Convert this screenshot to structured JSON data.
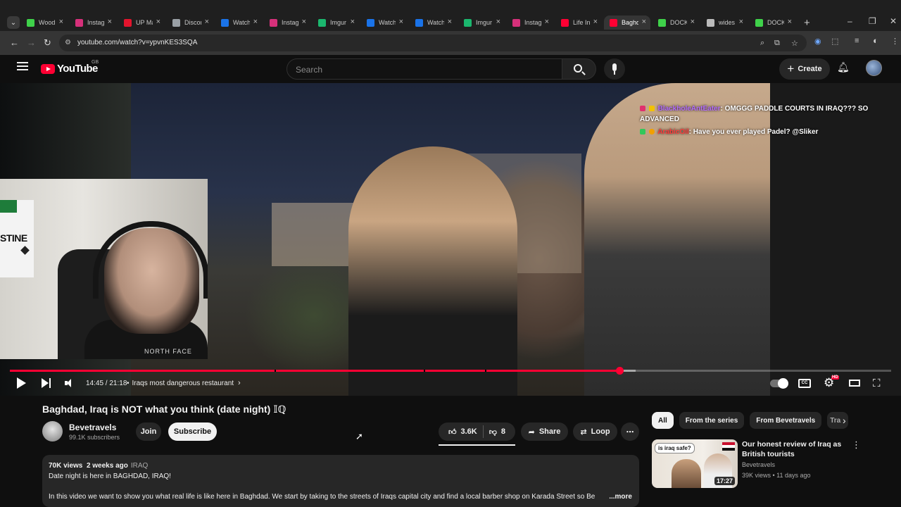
{
  "browser": {
    "tabs": [
      {
        "label": "Wood",
        "color": "#3fd14a"
      },
      {
        "label": "Instag",
        "color": "#d6307a"
      },
      {
        "label": "UP Ma",
        "color": "#e3142d"
      },
      {
        "label": "Discor",
        "color": "#9aa0a6"
      },
      {
        "label": "Watch",
        "color": "#1a73e8"
      },
      {
        "label": "Instag",
        "color": "#d6307a"
      },
      {
        "label": "Imgur",
        "color": "#1bb76e"
      },
      {
        "label": "Watch",
        "color": "#1a73e8"
      },
      {
        "label": "Watch",
        "color": "#1a73e8"
      },
      {
        "label": "Imgur",
        "color": "#1bb76e"
      },
      {
        "label": "Instag",
        "color": "#d6307a"
      },
      {
        "label": "Life In",
        "color": "#ff0033"
      },
      {
        "label": "Baghd",
        "color": "#ff0033",
        "active": true
      },
      {
        "label": "DOCK",
        "color": "#3fd14a"
      },
      {
        "label": "wides",
        "color": "#bbbbbb"
      },
      {
        "label": "DOCK",
        "color": "#3fd14a"
      }
    ],
    "url": "youtube.com/watch?v=ypvnKES3SQA"
  },
  "youtube": {
    "logo": "YouTube",
    "region": "GB",
    "search_placeholder": "Search",
    "create_label": "Create"
  },
  "player": {
    "chat": [
      {
        "user": "BlackholeAntEater",
        "message": ": OMGGG PADDLE COURTS IN IRAQ??? SO ADVANCED",
        "user_color": "#b36bff"
      },
      {
        "user": "ArabicOil",
        "message": ": Have you ever played Padel? @Sliker",
        "user_color": "#ff3b3b"
      }
    ],
    "webcam_poster_text": "STINE",
    "webcam_shirt_text": "NORTH FACE",
    "time": "14:45 / 21:18",
    "chapter": "Iraqs most dangerous restaurant",
    "progress_fraction": 0.692,
    "buffer_fraction": 0.71,
    "settings_badge": "HD",
    "cc_label": "CC"
  },
  "video": {
    "title": "Baghdad, Iraq is NOT what you think (date night) 𝕀ℚ",
    "channel": "Bevetravels",
    "subscribers": "99.1K subscribers",
    "join_label": "Join",
    "subscribe_label": "Subscribe",
    "likes": "3.6K",
    "dislikes": "8",
    "share_label": "Share",
    "loop_label": "Loop",
    "views": "70K views",
    "age": "2 weeks ago",
    "tag": "IRAQ",
    "desc_line1": "Date night is here in BAGHDAD, IRAQ!",
    "desc_line2": "In this video we want to show you what real life is like here in Baghdad. We start by taking to the streets of Iraqs capital city and find a local barber shop on Karada Street so Be",
    "desc_more": "...more"
  },
  "sidebar": {
    "chips": [
      "All",
      "From the series",
      "From Bevetravels",
      "Tra"
    ],
    "recommendation": {
      "thumb_text": "is iraq safe?",
      "duration": "17:27",
      "title": "Our honest review of Iraq as British tourists",
      "channel": "Bevetravels",
      "meta": "39K views • 11 days ago"
    }
  }
}
